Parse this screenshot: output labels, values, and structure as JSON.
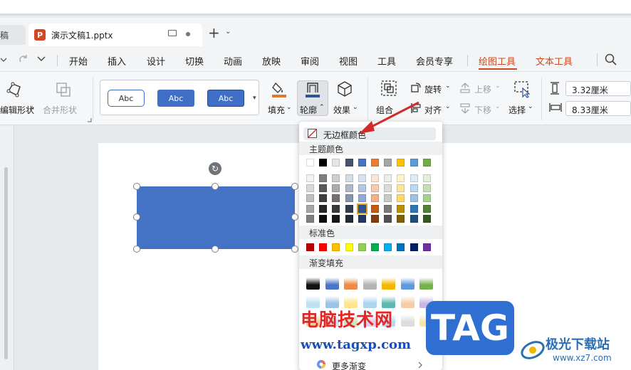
{
  "tabs": {
    "prev_label": "稿",
    "active_title": "演示文稿1.pptx",
    "app_icon_letter": "P"
  },
  "menu": {
    "items": [
      "开始",
      "插入",
      "设计",
      "切换",
      "动画",
      "放映",
      "审阅",
      "视图",
      "工具",
      "会员专享",
      "绘图工具",
      "文本工具"
    ]
  },
  "ribbon": {
    "edit_shape": "编辑形状",
    "merge_shape": "合并形状",
    "style_sample": "Abc",
    "fill": "填充",
    "outline": "轮廓",
    "effect": "效果",
    "group": "组合",
    "rotate": "旋转",
    "align": "对齐",
    "move_up": "上移",
    "move_down": "下移",
    "select": "选择",
    "width": "3.32厘米",
    "height": "8.33厘米"
  },
  "dropdown": {
    "no_border": "无边框颜色",
    "theme_colors_title": "主题颜色",
    "standard_colors_title": "标准色",
    "gradient_title": "渐变填充",
    "more_gradient": "更多渐变",
    "theme_top": [
      "#ffffff",
      "#000000",
      "#e7e6e6",
      "#44546a",
      "#4472c4",
      "#ed7d31",
      "#a5a5a5",
      "#ffc000",
      "#5b9bd5",
      "#70ad47"
    ],
    "theme_shades": [
      [
        "#f2f2f2",
        "#808080",
        "#d0cece",
        "#d6dce4",
        "#d9e2f3",
        "#fbe5d5",
        "#ededed",
        "#fff2cc",
        "#deebf6",
        "#e2efd9"
      ],
      [
        "#d9d9d9",
        "#595959",
        "#aeabab",
        "#adb9ca",
        "#b4c6e7",
        "#f7cbac",
        "#dbdbdb",
        "#fee599",
        "#bdd7ee",
        "#c5e0b3"
      ],
      [
        "#bfbfbf",
        "#3f3f3f",
        "#757070",
        "#8496b0",
        "#8eaadb",
        "#f4b183",
        "#c9c9c9",
        "#ffd965",
        "#9cc3e5",
        "#a8d08d"
      ],
      [
        "#a6a6a6",
        "#262626",
        "#3a3838",
        "#323f4f",
        "#2f5496",
        "#c55a11",
        "#7b7b7b",
        "#bf8f00",
        "#2e75b5",
        "#538135"
      ],
      [
        "#7f7f7f",
        "#0c0c0c",
        "#171616",
        "#222a35",
        "#1f3864",
        "#833c0b",
        "#525252",
        "#7f6000",
        "#1e4e79",
        "#375623"
      ]
    ],
    "standard": [
      "#c00000",
      "#ff0000",
      "#ffc000",
      "#ffff00",
      "#92d050",
      "#00b050",
      "#00b0f0",
      "#0070c0",
      "#002060",
      "#7030a0"
    ],
    "gradients_row1": [
      "#111111",
      "#4a75c8",
      "#ee8a44",
      "#b4b4b4",
      "#f2b800",
      "#5f9bdc",
      "#76b14c"
    ],
    "gradients_row2": [
      "#bfe0ef",
      "#9cc3e5",
      "#fee48a",
      "#a9d5ef",
      "#5fb8b0",
      "#f7cba7",
      "#cbb7e6"
    ],
    "gradients_row3": [
      "#f6c9a2",
      "#cfe2f4",
      "#c9e6c0",
      "#e6c9e6",
      "#b9d6ee",
      "#dddddd",
      "#f5e6a8"
    ]
  },
  "watermark": {
    "site_name": "电脑技术网",
    "site_url": "www.tagxp.com",
    "tag": "TAG",
    "logo_name": "极光下载站",
    "logo_url": "www.xz7.com"
  },
  "colors": {
    "accent": "#c94b1f",
    "shape_fill": "#4472c4"
  }
}
